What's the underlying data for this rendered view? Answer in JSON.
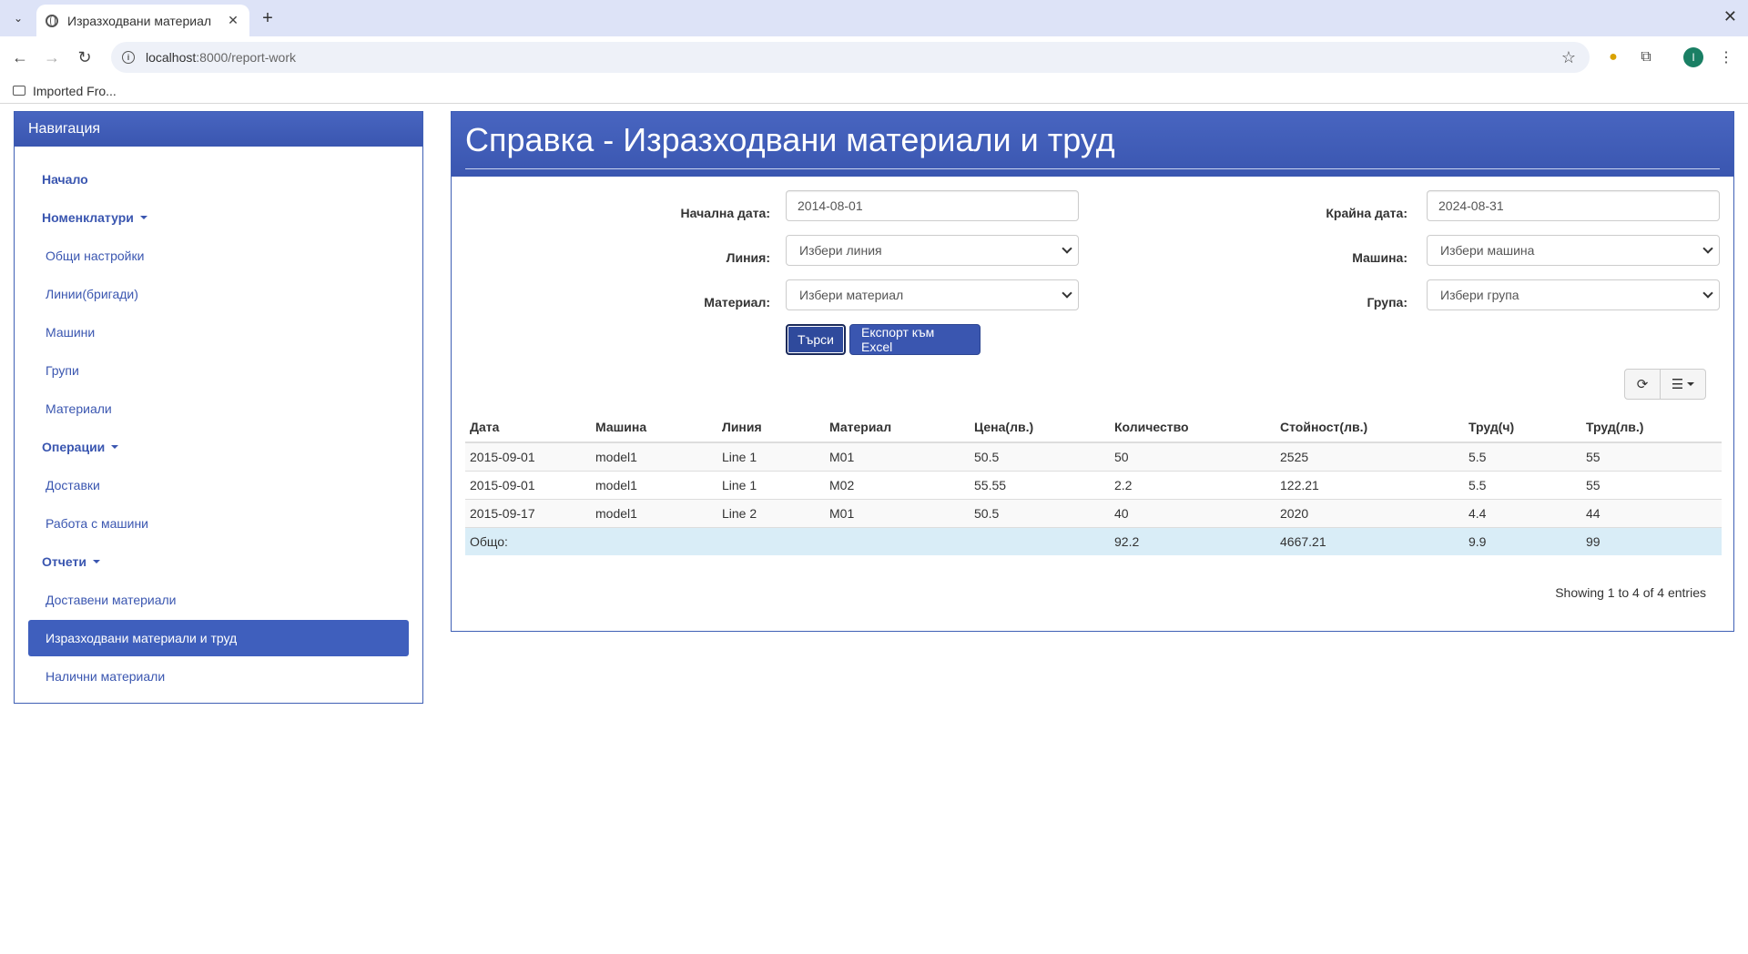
{
  "browser": {
    "tab_title": "Изразходвани материал",
    "url_host": "localhost",
    "url_rest": ":8000/report-work",
    "bookmark": "Imported Fro..."
  },
  "sidebar": {
    "title": "Навигация",
    "items": [
      {
        "label": "Начало"
      },
      {
        "label": "Номенклатури"
      },
      {
        "label": "Общи настройки"
      },
      {
        "label": "Линии(бригади)"
      },
      {
        "label": "Машини"
      },
      {
        "label": "Групи"
      },
      {
        "label": "Материали"
      },
      {
        "label": "Операции"
      },
      {
        "label": "Доставки"
      },
      {
        "label": "Работа с машини"
      },
      {
        "label": "Отчети"
      },
      {
        "label": "Доставени материали"
      },
      {
        "label": "Изразходвани материали и труд"
      },
      {
        "label": "Налични материали"
      }
    ]
  },
  "main": {
    "title": "Справка - Изразходвани материали и труд",
    "form": {
      "start_label": "Начална дата:",
      "start_value": "2014-08-01",
      "end_label": "Крайна дата:",
      "end_value": "2024-08-31",
      "line_label": "Линия:",
      "line_value": "Избери линия",
      "machine_label": "Машина:",
      "machine_value": "Избери машина",
      "material_label": "Материал:",
      "material_value": "Избери материал",
      "group_label": "Група:",
      "group_value": "Избери група",
      "search_button": "Търси",
      "excel_button": "Експорт към Excel"
    },
    "table": {
      "columns": [
        "Дата",
        "Машина",
        "Линия",
        "Материал",
        "Цена(лв.)",
        "Количество",
        "Стойност(лв.)",
        "Труд(ч)",
        "Труд(лв.)"
      ],
      "rows": [
        [
          "2015-09-01",
          "model1",
          "Line 1",
          "M01",
          "50.5",
          "50",
          "2525",
          "5.5",
          "55"
        ],
        [
          "2015-09-01",
          "model1",
          "Line 1",
          "M02",
          "55.55",
          "2.2",
          "122.21",
          "5.5",
          "55"
        ],
        [
          "2015-09-17",
          "model1",
          "Line 2",
          "M01",
          "50.5",
          "40",
          "2020",
          "4.4",
          "44"
        ]
      ],
      "total": [
        "Общо:",
        "",
        "",
        "",
        "",
        "92.2",
        "4667.21",
        "9.9",
        "99"
      ]
    },
    "entries_text": "Showing 1 to 4 of 4 entries"
  }
}
